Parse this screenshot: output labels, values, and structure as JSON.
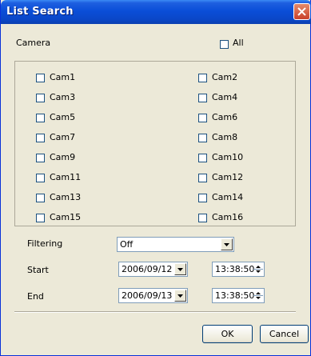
{
  "window": {
    "title": "List Search",
    "close_icon": "close-icon"
  },
  "camera": {
    "label": "Camera",
    "all_label": "All",
    "all_checked": false
  },
  "cameras": [
    {
      "label": "Cam1",
      "checked": false
    },
    {
      "label": "Cam2",
      "checked": false
    },
    {
      "label": "Cam3",
      "checked": false
    },
    {
      "label": "Cam4",
      "checked": false
    },
    {
      "label": "Cam5",
      "checked": false
    },
    {
      "label": "Cam6",
      "checked": false
    },
    {
      "label": "Cam7",
      "checked": false
    },
    {
      "label": "Cam8",
      "checked": false
    },
    {
      "label": "Cam9",
      "checked": false
    },
    {
      "label": "Cam10",
      "checked": false
    },
    {
      "label": "Cam11",
      "checked": false
    },
    {
      "label": "Cam12",
      "checked": false
    },
    {
      "label": "Cam13",
      "checked": false
    },
    {
      "label": "Cam14",
      "checked": false
    },
    {
      "label": "Cam15",
      "checked": false
    },
    {
      "label": "Cam16",
      "checked": false
    }
  ],
  "filtering": {
    "label": "Filtering",
    "value": "Off"
  },
  "start": {
    "label": "Start",
    "date": "2006/09/12",
    "time": "13:38:50"
  },
  "end": {
    "label": "End",
    "date": "2006/09/13",
    "time": "13:38:50"
  },
  "buttons": {
    "ok": "OK",
    "cancel": "Cancel"
  },
  "colors": {
    "titlebar": "#0a4ed8",
    "close": "#c9412a",
    "face": "#ece9d8"
  }
}
